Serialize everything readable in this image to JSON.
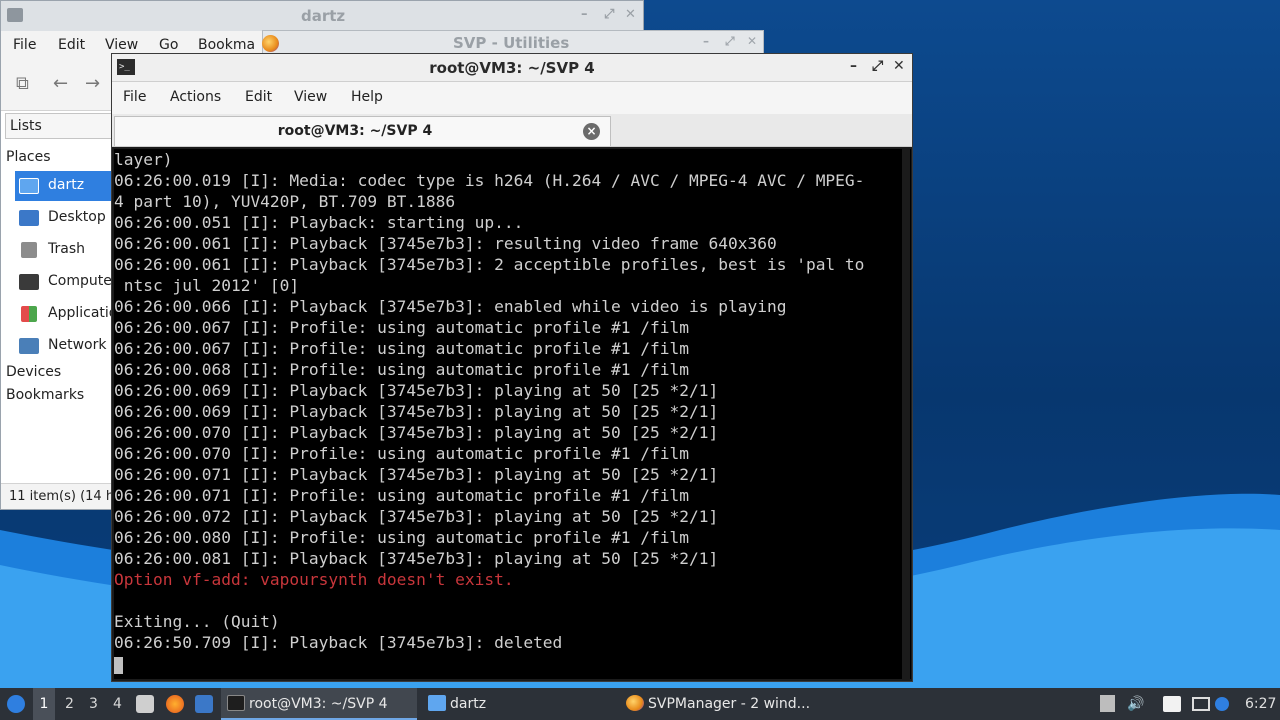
{
  "file_manager": {
    "title": "dartz",
    "menu": [
      "File",
      "Edit",
      "View",
      "Go",
      "Bookma"
    ],
    "sidebar_tab": "Lists",
    "places_heading": "Places",
    "places": [
      {
        "label": "dartz",
        "icon": "home-folder-icon",
        "selected": true
      },
      {
        "label": "Desktop",
        "icon": "desktop-icon",
        "selected": false
      },
      {
        "label": "Trash",
        "icon": "trash-icon",
        "selected": false
      },
      {
        "label": "Compute",
        "icon": "computer-icon",
        "selected": false
      },
      {
        "label": "Applicatio",
        "icon": "applications-icon",
        "selected": false
      },
      {
        "label": "Network",
        "icon": "network-icon",
        "selected": false
      }
    ],
    "devices_heading": "Devices",
    "bookmarks_heading": "Bookmarks",
    "status": "11 item(s) (14 h"
  },
  "svp_window": {
    "title": "SVP - Utilities"
  },
  "terminal": {
    "title": "root@VM3: ~/SVP 4",
    "menu": [
      "File",
      "Actions",
      "Edit",
      "View",
      "Help"
    ],
    "tab_label": "root@VM3: ~/SVP 4",
    "lines": [
      {
        "text": "layer)",
        "error": false
      },
      {
        "text": "06:26:00.019 [I]: Media: codec type is h264 (H.264 / AVC / MPEG-4 AVC / MPEG-",
        "error": false
      },
      {
        "text": "4 part 10), YUV420P, BT.709 BT.1886",
        "error": false
      },
      {
        "text": "06:26:00.051 [I]: Playback: starting up...",
        "error": false
      },
      {
        "text": "06:26:00.061 [I]: Playback [3745e7b3]: resulting video frame 640x360",
        "error": false
      },
      {
        "text": "06:26:00.061 [I]: Playback [3745e7b3]: 2 acceptible profiles, best is 'pal to",
        "error": false
      },
      {
        "text": " ntsc jul 2012' [0]",
        "error": false
      },
      {
        "text": "06:26:00.066 [I]: Playback [3745e7b3]: enabled while video is playing",
        "error": false
      },
      {
        "text": "06:26:00.067 [I]: Profile: using automatic profile #1 /film",
        "error": false
      },
      {
        "text": "06:26:00.067 [I]: Profile: using automatic profile #1 /film",
        "error": false
      },
      {
        "text": "06:26:00.068 [I]: Profile: using automatic profile #1 /film",
        "error": false
      },
      {
        "text": "06:26:00.069 [I]: Playback [3745e7b3]: playing at 50 [25 *2/1]",
        "error": false
      },
      {
        "text": "06:26:00.069 [I]: Playback [3745e7b3]: playing at 50 [25 *2/1]",
        "error": false
      },
      {
        "text": "06:26:00.070 [I]: Playback [3745e7b3]: playing at 50 [25 *2/1]",
        "error": false
      },
      {
        "text": "06:26:00.070 [I]: Profile: using automatic profile #1 /film",
        "error": false
      },
      {
        "text": "06:26:00.071 [I]: Playback [3745e7b3]: playing at 50 [25 *2/1]",
        "error": false
      },
      {
        "text": "06:26:00.071 [I]: Profile: using automatic profile #1 /film",
        "error": false
      },
      {
        "text": "06:26:00.072 [I]: Playback [3745e7b3]: playing at 50 [25 *2/1]",
        "error": false
      },
      {
        "text": "06:26:00.080 [I]: Profile: using automatic profile #1 /film",
        "error": false
      },
      {
        "text": "06:26:00.081 [I]: Playback [3745e7b3]: playing at 50 [25 *2/1]",
        "error": false
      },
      {
        "text": "Option vf-add: vapoursynth doesn't exist.",
        "error": true
      },
      {
        "text": "",
        "error": false
      },
      {
        "text": "Exiting... (Quit)",
        "error": false
      },
      {
        "text": "06:26:50.709 [I]: Playback [3745e7b3]: deleted",
        "error": false
      }
    ],
    "colors": {
      "background": "#000000",
      "text": "#cfcfcf",
      "error": "#c8363b"
    }
  },
  "taskbar": {
    "workspaces": [
      "1",
      "2",
      "3",
      "4"
    ],
    "active_workspace": "1",
    "tasks": [
      {
        "label": "root@VM3: ~/SVP 4",
        "icon": "terminal-icon",
        "active": true
      },
      {
        "label": "dartz",
        "icon": "folder-icon",
        "active": false
      },
      {
        "label": "SVPManager - 2 wind...",
        "icon": "svp-icon",
        "active": false
      }
    ],
    "clock": "6:27"
  }
}
